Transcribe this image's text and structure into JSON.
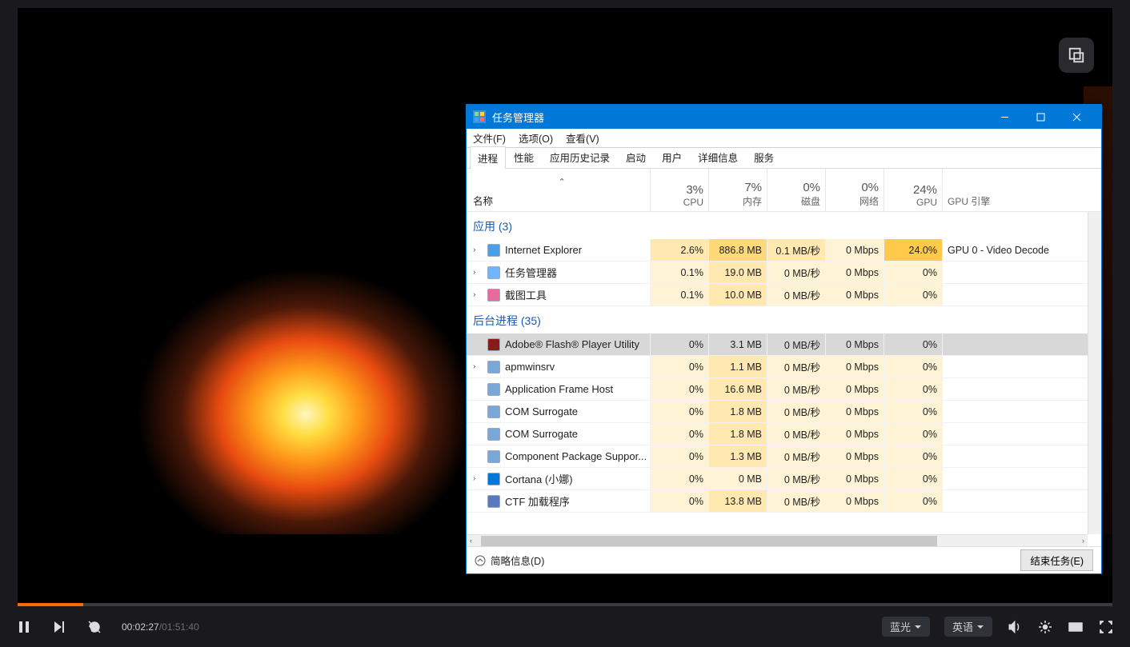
{
  "video": {
    "current_time": "00:02:27",
    "duration": "01:51:40",
    "quality": "蓝光",
    "language": "英语"
  },
  "tm": {
    "title": "任务管理器",
    "menu": [
      "文件(F)",
      "选项(O)",
      "查看(V)"
    ],
    "tabs": [
      "进程",
      "性能",
      "应用历史记录",
      "启动",
      "用户",
      "详细信息",
      "服务"
    ],
    "header": {
      "name": "名称",
      "cols": [
        {
          "pct": "3%",
          "lbl": "CPU"
        },
        {
          "pct": "7%",
          "lbl": "内存"
        },
        {
          "pct": "0%",
          "lbl": "磁盘"
        },
        {
          "pct": "0%",
          "lbl": "网络"
        },
        {
          "pct": "24%",
          "lbl": "GPU"
        }
      ],
      "engine": "GPU 引擎"
    },
    "groups": {
      "apps": "应用 (3)",
      "bg": "后台进程 (35)"
    },
    "rows_apps": [
      {
        "exp": "›",
        "name": "Internet Explorer",
        "cpu": "2.6%",
        "mem": "886.8 MB",
        "dsk": "0.1 MB/秒",
        "net": "0 Mbps",
        "gpu": "24.0%",
        "eng": "GPU 0 - Video Decode",
        "heat": [
          "h2",
          "h3",
          "h2",
          "h1",
          "h4",
          ""
        ],
        "icon": "#4aa0e8"
      },
      {
        "exp": "›",
        "name": "任务管理器",
        "cpu": "0.1%",
        "mem": "19.0 MB",
        "dsk": "0 MB/秒",
        "net": "0 Mbps",
        "gpu": "0%",
        "eng": "",
        "heat": [
          "h1",
          "h2",
          "h1",
          "h1",
          "h1",
          ""
        ],
        "icon": "#6fb6ff"
      },
      {
        "exp": "›",
        "name": "截图工具",
        "cpu": "0.1%",
        "mem": "10.0 MB",
        "dsk": "0 MB/秒",
        "net": "0 Mbps",
        "gpu": "0%",
        "eng": "",
        "heat": [
          "h1",
          "h2",
          "h1",
          "h1",
          "h1",
          ""
        ],
        "icon": "#e86aa0"
      }
    ],
    "rows_bg": [
      {
        "exp": "",
        "name": "Adobe® Flash® Player Utility",
        "cpu": "0%",
        "mem": "3.1 MB",
        "dsk": "0 MB/秒",
        "net": "0 Mbps",
        "gpu": "0%",
        "eng": "",
        "sel": true,
        "icon": "#8a1a1a"
      },
      {
        "exp": "›",
        "name": "apmwinsrv",
        "cpu": "0%",
        "mem": "1.1 MB",
        "dsk": "0 MB/秒",
        "net": "0 Mbps",
        "gpu": "0%",
        "eng": "",
        "heat": [
          "h1",
          "h2",
          "h1",
          "h1",
          "h1",
          ""
        ],
        "icon": "#7aa7d8"
      },
      {
        "exp": "",
        "name": "Application Frame Host",
        "cpu": "0%",
        "mem": "16.6 MB",
        "dsk": "0 MB/秒",
        "net": "0 Mbps",
        "gpu": "0%",
        "eng": "",
        "heat": [
          "h1",
          "h2",
          "h1",
          "h1",
          "h1",
          ""
        ],
        "icon": "#7aa7d8"
      },
      {
        "exp": "",
        "name": "COM Surrogate",
        "cpu": "0%",
        "mem": "1.8 MB",
        "dsk": "0 MB/秒",
        "net": "0 Mbps",
        "gpu": "0%",
        "eng": "",
        "heat": [
          "h1",
          "h2",
          "h1",
          "h1",
          "h1",
          ""
        ],
        "icon": "#7aa7d8"
      },
      {
        "exp": "",
        "name": "COM Surrogate",
        "cpu": "0%",
        "mem": "1.8 MB",
        "dsk": "0 MB/秒",
        "net": "0 Mbps",
        "gpu": "0%",
        "eng": "",
        "heat": [
          "h1",
          "h2",
          "h1",
          "h1",
          "h1",
          ""
        ],
        "icon": "#7aa7d8"
      },
      {
        "exp": "",
        "name": "Component Package Suppor...",
        "cpu": "0%",
        "mem": "1.3 MB",
        "dsk": "0 MB/秒",
        "net": "0 Mbps",
        "gpu": "0%",
        "eng": "",
        "heat": [
          "h1",
          "h2",
          "h1",
          "h1",
          "h1",
          ""
        ],
        "icon": "#7aa7d8"
      },
      {
        "exp": "›",
        "name": "Cortana (小娜)",
        "cpu": "0%",
        "mem": "0 MB",
        "dsk": "0 MB/秒",
        "net": "0 Mbps",
        "gpu": "0%",
        "eng": "",
        "heat": [
          "h1",
          "h1",
          "h1",
          "h1",
          "h1",
          ""
        ],
        "icon": "#0078d7"
      },
      {
        "exp": "",
        "name": "CTF 加载程序",
        "cpu": "0%",
        "mem": "13.8 MB",
        "dsk": "0 MB/秒",
        "net": "0 Mbps",
        "gpu": "0%",
        "eng": "",
        "heat": [
          "h1",
          "h2",
          "h1",
          "h1",
          "h1",
          ""
        ],
        "icon": "#5a7ac0"
      }
    ],
    "footer": {
      "less": "简略信息(D)",
      "end": "结束任务(E)"
    }
  }
}
